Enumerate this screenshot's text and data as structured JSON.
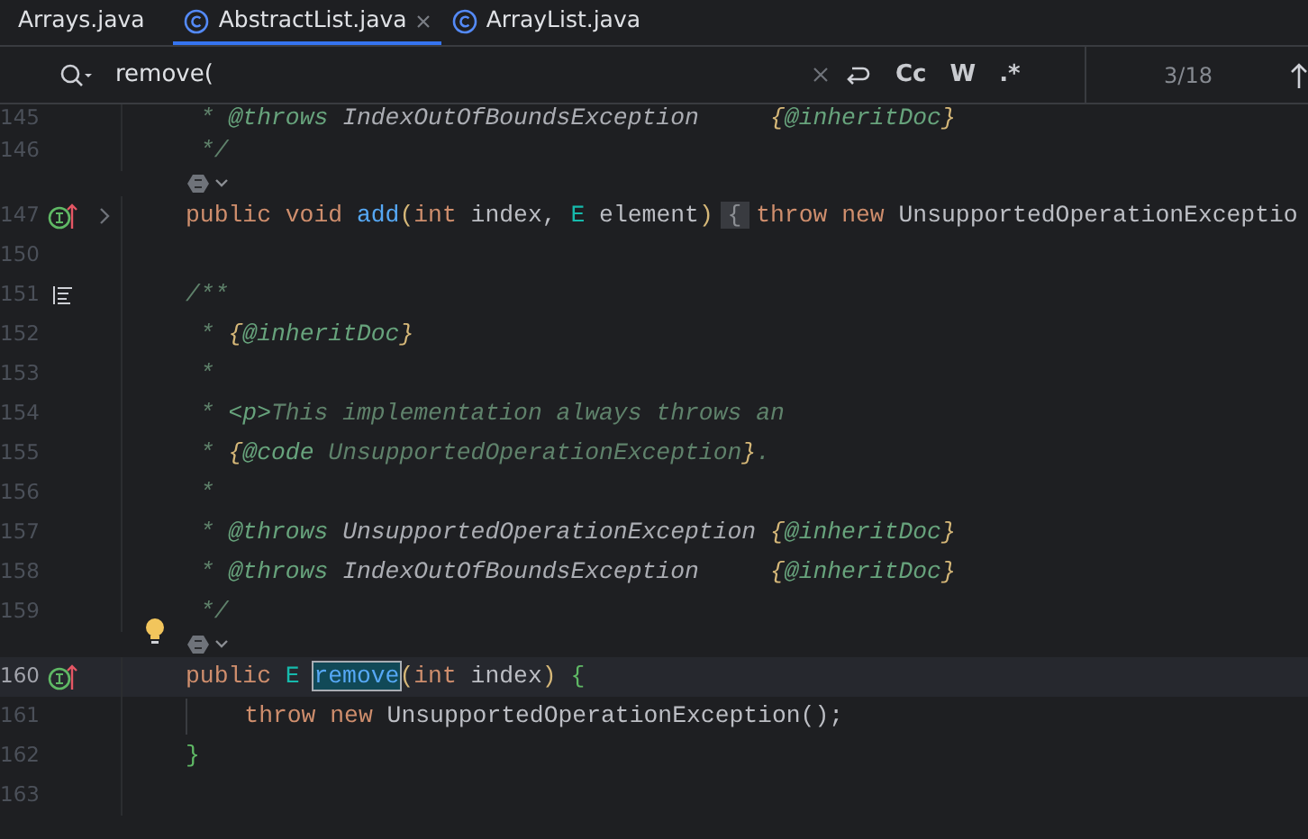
{
  "tabs": [
    {
      "label": "Arrays.java",
      "selected": false,
      "closable": false,
      "icon": false
    },
    {
      "label": "AbstractList.java",
      "selected": true,
      "closable": true,
      "icon": true
    },
    {
      "label": "ArrayList.java",
      "selected": false,
      "closable": false,
      "icon": true
    }
  ],
  "search": {
    "value": "remove(",
    "options": [
      "Cc",
      "W",
      ".*"
    ],
    "count": "3/18"
  },
  "lines": [
    {
      "kind": "code",
      "number": "145",
      "tokens": [
        {
          "kind": "doc",
          "text": " * "
        },
        {
          "kind": "doctag",
          "text": "@throws"
        },
        {
          "kind": "docref",
          "text": " IndexOutOfBoundsException     "
        },
        {
          "kind": "docbrace",
          "text": "{"
        },
        {
          "kind": "doctag",
          "text": "@inheritDoc"
        },
        {
          "kind": "docbrace",
          "text": "}"
        }
      ]
    },
    {
      "kind": "code",
      "number": "146",
      "tokens": [
        {
          "kind": "doc",
          "text": " */"
        }
      ]
    },
    {
      "kind": "inlay"
    },
    {
      "kind": "code",
      "number": "147",
      "gutter": {
        "kind": "implements"
      },
      "fold": true,
      "tokens": [
        {
          "kind": "kw",
          "text": "public void "
        },
        {
          "kind": "method",
          "text": "add"
        },
        {
          "kind": "paren",
          "text": "("
        },
        {
          "kind": "kw",
          "text": "int"
        },
        {
          "kind": "plain",
          "text": " index, "
        },
        {
          "kind": "tparam",
          "text": "E"
        },
        {
          "kind": "plain",
          "text": " element"
        },
        {
          "kind": "paren",
          "text": ") "
        },
        {
          "kind": "fold",
          "text": "{"
        },
        {
          "kind": "kw",
          "text": " throw new "
        },
        {
          "kind": "plain",
          "text": "UnsupportedOperationExceptio"
        }
      ]
    },
    {
      "kind": "code",
      "number": "150"
    },
    {
      "kind": "code",
      "number": "151",
      "gutter": {
        "kind": "doc-toggle"
      },
      "tokens": [
        {
          "kind": "doc",
          "text": "/**"
        }
      ]
    },
    {
      "kind": "code",
      "number": "152",
      "tokens": [
        {
          "kind": "doc",
          "text": " * "
        },
        {
          "kind": "docbrace",
          "text": "{"
        },
        {
          "kind": "doctag",
          "text": "@inheritDoc"
        },
        {
          "kind": "docbrace",
          "text": "}"
        }
      ]
    },
    {
      "kind": "code",
      "number": "153",
      "tokens": [
        {
          "kind": "doc",
          "text": " *"
        }
      ]
    },
    {
      "kind": "code",
      "number": "154",
      "tokens": [
        {
          "kind": "doc",
          "text": " * "
        },
        {
          "kind": "doctag",
          "text": "<p>"
        },
        {
          "kind": "doc",
          "text": "This implementation always throws an"
        }
      ]
    },
    {
      "kind": "code",
      "number": "155",
      "tokens": [
        {
          "kind": "doc",
          "text": " * "
        },
        {
          "kind": "docbrace",
          "text": "{"
        },
        {
          "kind": "doctag",
          "text": "@code"
        },
        {
          "kind": "doc",
          "text": " UnsupportedOperationException"
        },
        {
          "kind": "docbrace",
          "text": "}"
        },
        {
          "kind": "doc",
          "text": "."
        }
      ]
    },
    {
      "kind": "code",
      "number": "156",
      "tokens": [
        {
          "kind": "doc",
          "text": " *"
        }
      ]
    },
    {
      "kind": "code",
      "number": "157",
      "tokens": [
        {
          "kind": "doc",
          "text": " * "
        },
        {
          "kind": "doctag",
          "text": "@throws"
        },
        {
          "kind": "docref",
          "text": " UnsupportedOperationException "
        },
        {
          "kind": "docbrace",
          "text": "{"
        },
        {
          "kind": "doctag",
          "text": "@inheritDoc"
        },
        {
          "kind": "docbrace",
          "text": "}"
        }
      ]
    },
    {
      "kind": "code",
      "number": "158",
      "tokens": [
        {
          "kind": "doc",
          "text": " * "
        },
        {
          "kind": "doctag",
          "text": "@throws"
        },
        {
          "kind": "docref",
          "text": " IndexOutOfBoundsException     "
        },
        {
          "kind": "docbrace",
          "text": "{"
        },
        {
          "kind": "doctag",
          "text": "@inheritDoc"
        },
        {
          "kind": "docbrace",
          "text": "}"
        }
      ]
    },
    {
      "kind": "code",
      "number": "159",
      "bulb": true,
      "tokens": [
        {
          "kind": "doc",
          "text": " */"
        }
      ]
    },
    {
      "kind": "inlay"
    },
    {
      "kind": "code",
      "number": "160",
      "gutter": {
        "kind": "implements"
      },
      "current": true,
      "tokens": [
        {
          "kind": "kw",
          "text": "public "
        },
        {
          "kind": "tparam",
          "text": "E "
        },
        {
          "kind": "match",
          "text": "remove"
        },
        {
          "kind": "paren",
          "text": "("
        },
        {
          "kind": "kw",
          "text": "int"
        },
        {
          "kind": "plain",
          "text": " index"
        },
        {
          "kind": "paren",
          "text": ") "
        },
        {
          "kind": "brace",
          "text": "{"
        }
      ]
    },
    {
      "kind": "code",
      "number": "161",
      "guide": true,
      "tokens": [
        {
          "kind": "kw",
          "text": "    throw new "
        },
        {
          "kind": "plain",
          "text": "UnsupportedOperationException();"
        }
      ]
    },
    {
      "kind": "code",
      "number": "162",
      "tokens": [
        {
          "kind": "brace",
          "text": "}"
        }
      ]
    },
    {
      "kind": "code",
      "number": "163"
    }
  ]
}
